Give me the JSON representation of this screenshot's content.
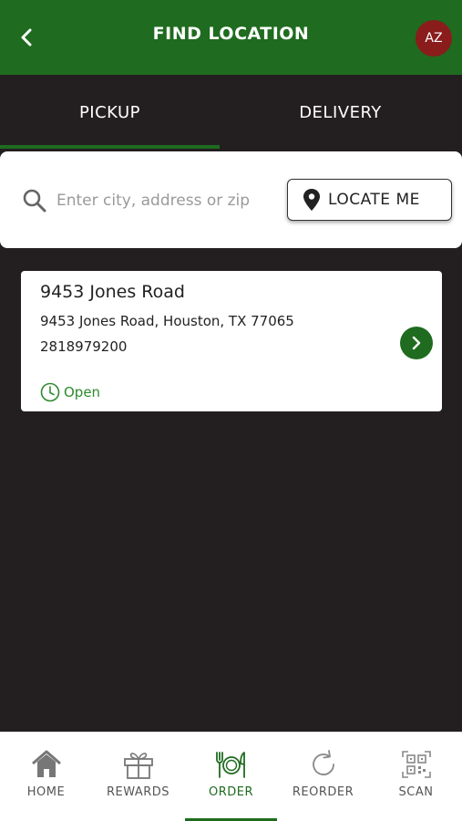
{
  "header": {
    "title": "FIND LOCATION",
    "avatar_initials": "AZ",
    "back_icon": "chevron-left-icon"
  },
  "tabs": [
    {
      "label": "PICKUP",
      "active": true
    },
    {
      "label": "DELIVERY",
      "active": false
    }
  ],
  "search": {
    "placeholder": "Enter city, address or zip",
    "value": "",
    "locate_label": "LOCATE ME"
  },
  "stores": [
    {
      "name": "9453 Jones Road",
      "address": "9453 Jones Road, Houston, TX 77065",
      "phone": "2818979200",
      "status": "Open"
    }
  ],
  "bottom_nav": [
    {
      "label": "HOME",
      "icon": "home-icon",
      "active": false
    },
    {
      "label": "REWARDS",
      "icon": "gift-icon",
      "active": false
    },
    {
      "label": "ORDER",
      "icon": "utensils-plate-icon",
      "active": true
    },
    {
      "label": "REORDER",
      "icon": "refresh-icon",
      "active": false
    },
    {
      "label": "SCAN",
      "icon": "qr-code-icon",
      "active": false
    }
  ],
  "colors": {
    "brand_green": "#1f6b1f",
    "background": "#231f20",
    "avatar": "#8a1c1c",
    "status_open": "#2e8b2e"
  }
}
